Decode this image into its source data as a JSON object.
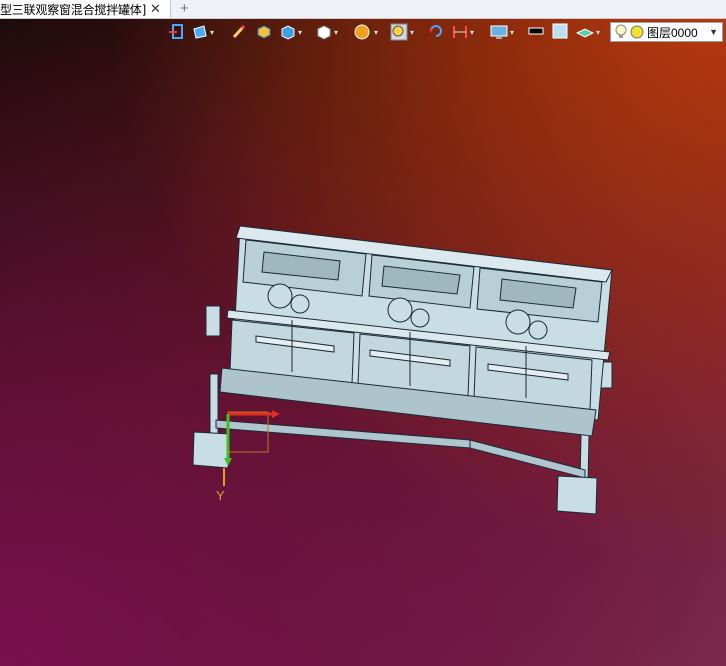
{
  "tab": {
    "title": "型三联观察窗混合搅拌罐体]",
    "close": "✕",
    "add": "+"
  },
  "toolbar": {
    "icons": [
      "exit-icon",
      "view-orientation-icon",
      "pencil-icon",
      "shaded-box-icon",
      "cube-icon",
      "white-cube-icon",
      "sphere-render-icon",
      "zoom-icon",
      "rotate-icon",
      "dimension-icon",
      "monitor-icon",
      "line-color-icon",
      "fill-color-icon",
      "layer-shape-icon",
      "light-bulb-icon"
    ],
    "layer_select": {
      "label": "图层0000"
    }
  },
  "axis": {
    "y_label": "Y"
  },
  "colors": {
    "model_face": "#c8dde4",
    "model_edge": "#1a2a36",
    "axis_x": "#e03020",
    "axis_y": "#40c020"
  }
}
